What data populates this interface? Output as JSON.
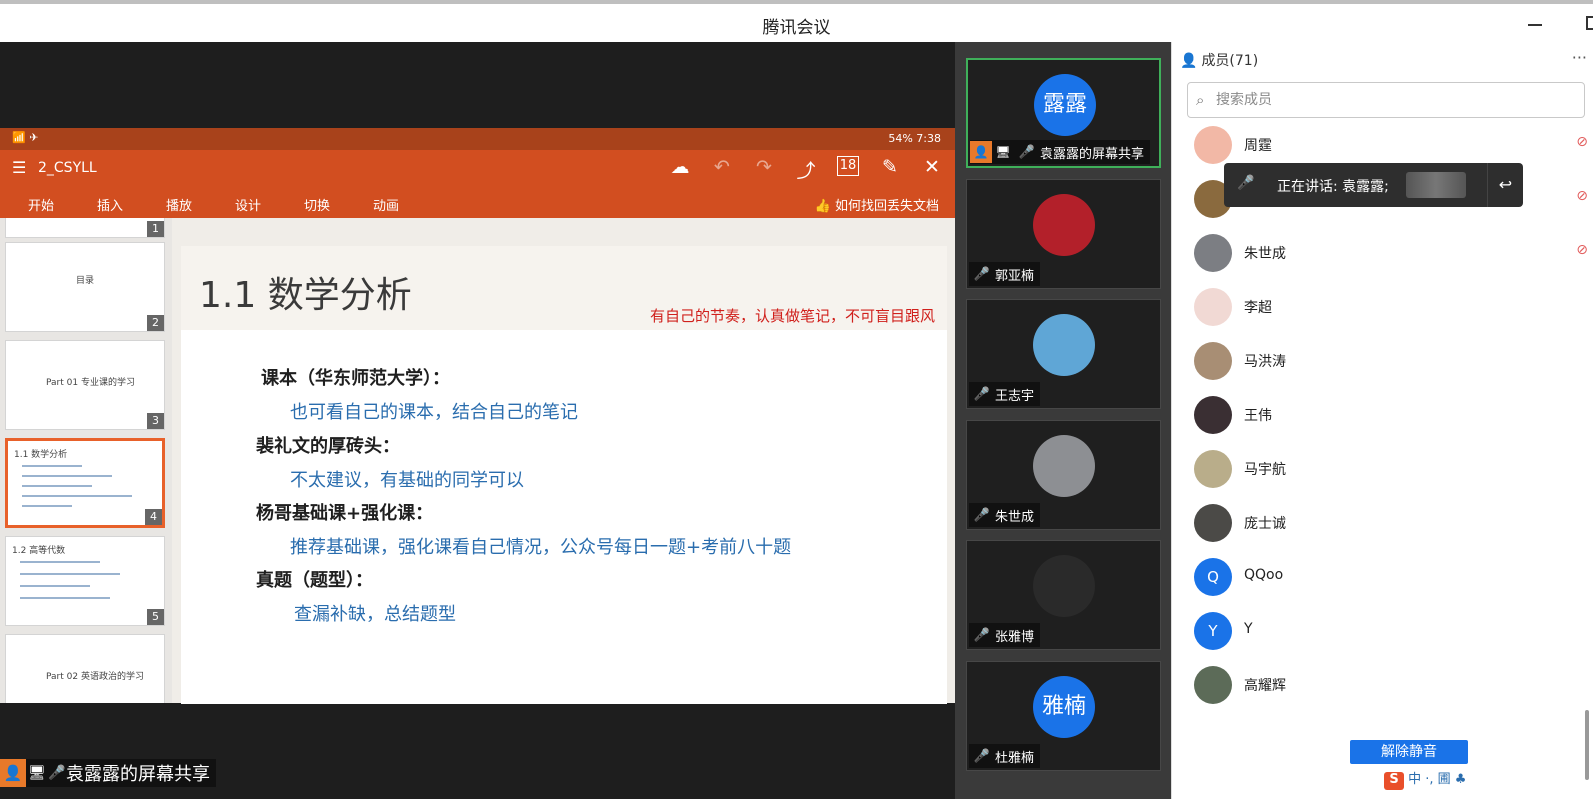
{
  "window": {
    "title": "腾讯会议"
  },
  "share": {
    "side_tab_icon": "chevron-right",
    "statusbar": {
      "left": "📶 ✈",
      "right": "54%  7:38"
    },
    "app": {
      "file_name": "2_CSYLL",
      "menu_icon": "☰",
      "tools": [
        "☁",
        "↶",
        "↷",
        "⤴",
        "18",
        "✎",
        "✕"
      ]
    },
    "ribbon": {
      "tabs": [
        "开始",
        "插入",
        "播放",
        "设计",
        "切换",
        "动画"
      ],
      "help": "如何找回丢失文档"
    },
    "thumbnails": [
      {
        "num": "1",
        "title": ""
      },
      {
        "num": "2",
        "title": "目录"
      },
      {
        "num": "3",
        "title": "Part 01  专业课的学习"
      },
      {
        "num": "4",
        "title": "1.1 数学分析"
      },
      {
        "num": "5",
        "title": "1.2 高等代数"
      },
      {
        "num": "",
        "title": "Part 02  英语政治的学习"
      }
    ],
    "slide": {
      "title": "1.1 数学分析",
      "motto": "有自己的节奏，认真做笔记，不可盲目跟风",
      "lines": [
        {
          "kind": "h",
          "text": "课本（华东师范大学）："
        },
        {
          "kind": "b",
          "text": "也可看自己的课本，结合自己的笔记"
        },
        {
          "kind": "h",
          "text": "裴礼文的厚砖头："
        },
        {
          "kind": "b",
          "text": "不太建议，有基础的同学可以"
        },
        {
          "kind": "h",
          "text": "杨哥基础课+强化课："
        },
        {
          "kind": "b",
          "text": "推荐基础课，强化课看自己情况，公众号每日一题+考前八十题"
        },
        {
          "kind": "h",
          "text": "真题（题型）："
        },
        {
          "kind": "b",
          "text": "查漏补缺，总结题型"
        }
      ]
    },
    "sharer_label": "袁露露的屏幕共享"
  },
  "videos": [
    {
      "name": "袁露露的屏幕共享",
      "avatar_text": "露露",
      "avatar_color": "#1a73e8",
      "active": true,
      "muted": false,
      "sharing": true
    },
    {
      "name": "郭亚楠",
      "avatar_text": "",
      "avatar_color": "#b3202a",
      "active": false,
      "muted": true,
      "sharing": false
    },
    {
      "name": "王志宇",
      "avatar_text": "",
      "avatar_color": "#5fa6d6",
      "active": false,
      "muted": true,
      "sharing": false
    },
    {
      "name": "朱世成",
      "avatar_text": "",
      "avatar_color": "#8d8f93",
      "active": false,
      "muted": true,
      "sharing": false
    },
    {
      "name": "张雅博",
      "avatar_text": "",
      "avatar_color": "#2a2a2a",
      "active": false,
      "muted": true,
      "sharing": true
    },
    {
      "name": "杜雅楠",
      "avatar_text": "雅楠",
      "avatar_color": "#1a73e8",
      "active": false,
      "muted": true,
      "sharing": false
    }
  ],
  "members": {
    "header": "成员(71)",
    "more": "···",
    "search_placeholder": "搜索成员",
    "speaking": {
      "text": "正在讲话: 袁露露;"
    },
    "list": [
      {
        "name": "周霆",
        "avatar_text": "",
        "avatar_color": "#f2b8a6",
        "muted": true
      },
      {
        "name": "",
        "avatar_text": "",
        "avatar_color": "#8a6a3e",
        "muted": true
      },
      {
        "name": "朱世成",
        "avatar_text": "",
        "avatar_color": "#7c7e83",
        "muted": true
      },
      {
        "name": "李超",
        "avatar_text": "",
        "avatar_color": "#f1d9d4",
        "muted": false
      },
      {
        "name": "马洪涛",
        "avatar_text": "",
        "avatar_color": "#a88e74",
        "muted": false
      },
      {
        "name": "王伟",
        "avatar_text": "",
        "avatar_color": "#3a2f33",
        "muted": false
      },
      {
        "name": "马宇航",
        "avatar_text": "",
        "avatar_color": "#b9ad8a",
        "muted": false
      },
      {
        "name": "庞士诚",
        "avatar_text": "",
        "avatar_color": "#4b4a47",
        "muted": false
      },
      {
        "name": "QQoo",
        "avatar_text": "Q",
        "avatar_color": "#1a73e8",
        "muted": false
      },
      {
        "name": "Y",
        "avatar_text": "Y",
        "avatar_color": "#1a73e8",
        "muted": false
      },
      {
        "name": "高耀辉",
        "avatar_text": "",
        "avatar_color": "#5c6b58",
        "muted": false
      }
    ],
    "unmute_label": "解除静音",
    "ime_text": "中 ·, 圃 ♣"
  }
}
